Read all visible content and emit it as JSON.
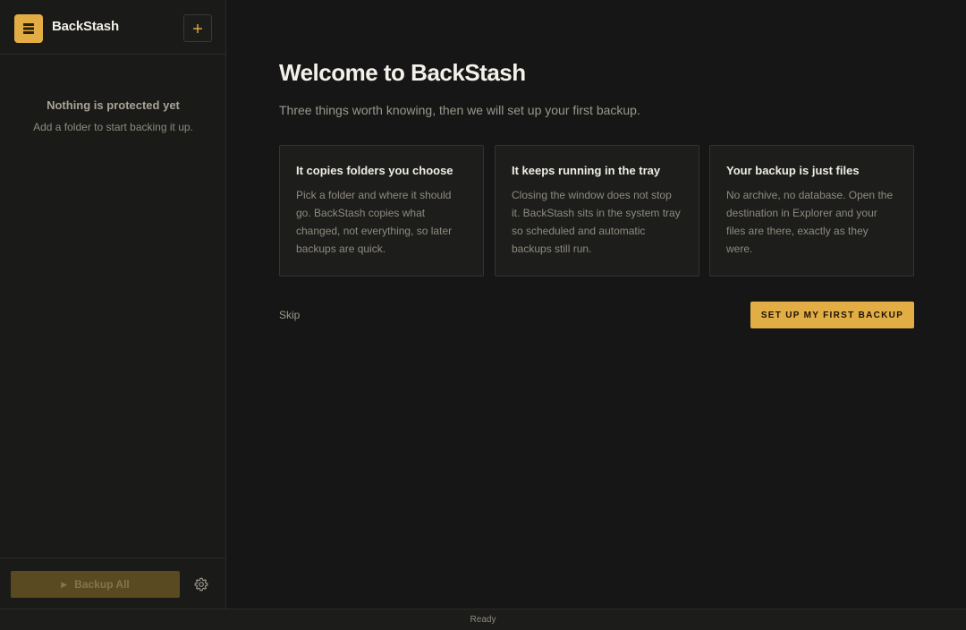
{
  "app": {
    "name": "BackStash",
    "accent_color": "#e2ad44"
  },
  "sidebar": {
    "add_button_icon": "plus-icon",
    "empty_state": {
      "title": "Nothing is protected yet",
      "subtitle": "Add a folder to start backing it up."
    },
    "backup_all_label": "Backup All",
    "backup_all_disabled": true,
    "settings_icon": "gear-icon"
  },
  "main": {
    "title": "Welcome to BackStash",
    "subtitle": "Three things worth knowing, then we will set up your first backup.",
    "cards": [
      {
        "title": "It copies folders you choose",
        "body": "Pick a folder and where it should go. BackStash copies what changed, not everything, so later backups are quick."
      },
      {
        "title": "It keeps running in the tray",
        "body": "Closing the window does not stop it. BackStash sits in the system tray so scheduled and automatic backups still run."
      },
      {
        "title": "Your backup is just files",
        "body": "No archive, no database. Open the destination in Explorer and your files are there, exactly as they were."
      }
    ],
    "skip_label": "Skip",
    "cta_label": "SET UP MY FIRST BACKUP"
  },
  "statusbar": {
    "text": "Ready"
  }
}
